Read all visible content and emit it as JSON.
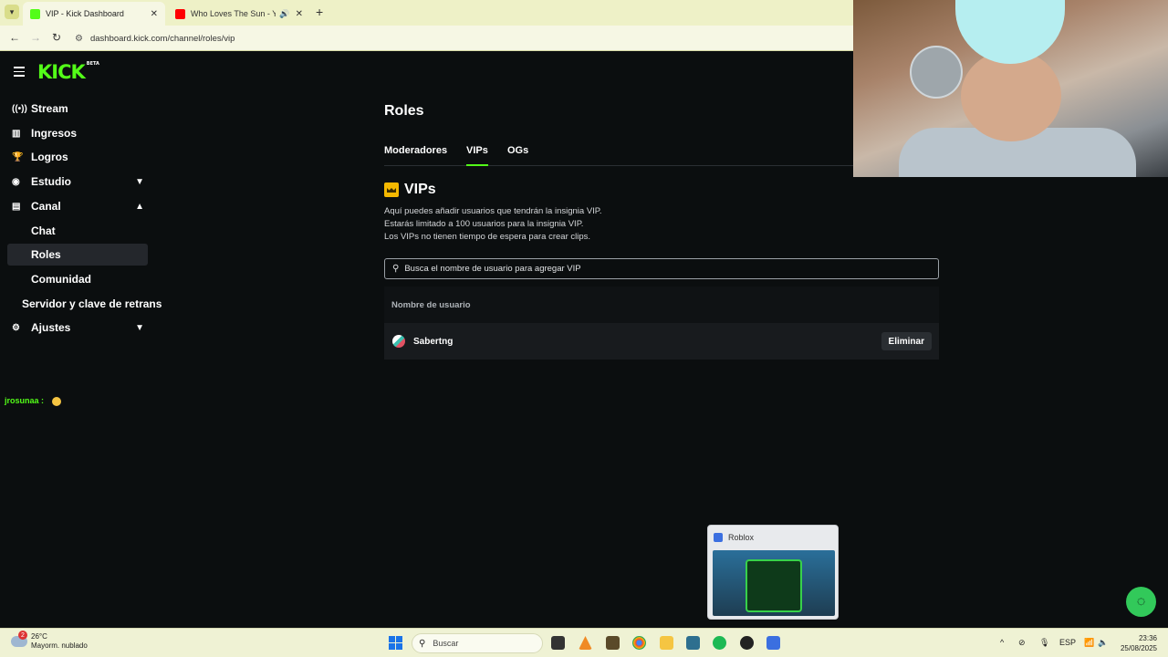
{
  "browser": {
    "tabs": [
      {
        "title": "VIP - Kick Dashboard",
        "active": true
      },
      {
        "title": "Who Loves The Sun - YouTube",
        "active": false
      }
    ],
    "url": "dashboard.kick.com/channel/roles/vip"
  },
  "app": {
    "logo": "KICK",
    "logo_badge": "BETA",
    "sidebar": {
      "items": [
        {
          "label": "Stream",
          "icon": "broadcast-icon"
        },
        {
          "label": "Ingresos",
          "icon": "chart-icon"
        },
        {
          "label": "Logros",
          "icon": "trophy-icon"
        },
        {
          "label": "Estudio",
          "icon": "studio-icon",
          "expanded": false
        },
        {
          "label": "Canal",
          "icon": "channel-icon",
          "expanded": true
        },
        {
          "label": "Chat"
        },
        {
          "label": "Roles",
          "active": true
        },
        {
          "label": "Comunidad"
        },
        {
          "label": "Servidor y clave de retrans"
        },
        {
          "label": "Ajustes",
          "icon": "gear-icon",
          "expanded": false
        }
      ]
    },
    "chat_overlay": {
      "user": "jrosunaa :"
    }
  },
  "main": {
    "title": "Roles",
    "tabs": [
      {
        "label": "Moderadores"
      },
      {
        "label": "VIPs",
        "active": true
      },
      {
        "label": "OGs"
      }
    ],
    "section_title": "VIPs",
    "description": [
      "Aquí puedes añadir usuarios que tendrán la insignia VIP.",
      "Estarás limitado a 100 usuarios para la insignia VIP.",
      "Los VIPs no tienen tiempo de espera para crear clips."
    ],
    "search_placeholder": "Busca el nombre de usuario para agregar VIP",
    "table": {
      "header": "Nombre de usuario",
      "rows": [
        {
          "username": "Sabertng",
          "action": "Eliminar"
        }
      ]
    }
  },
  "popup": {
    "title": "Roblox"
  },
  "taskbar": {
    "weather_temp": "26°C",
    "weather_desc": "Mayorm. nublado",
    "weather_badge": "2",
    "search": "Buscar",
    "lang": "ESP",
    "time": "23:36",
    "date": "25/08/2025"
  },
  "colors": {
    "accent": "#53fc18",
    "background": "#0b0e0f",
    "help": "#32c95a"
  }
}
